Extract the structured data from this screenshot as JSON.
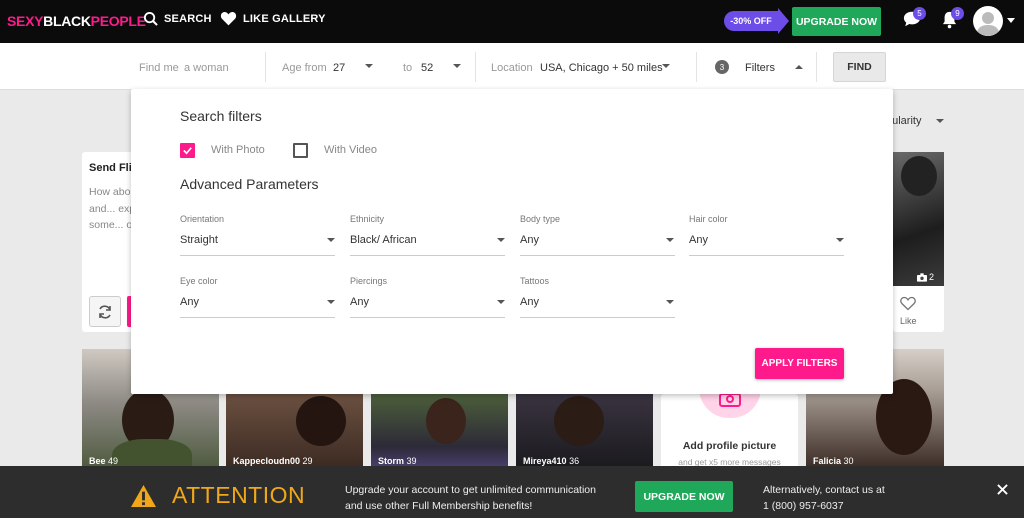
{
  "header": {
    "logo_part1": "SEXY",
    "logo_part2": "BLACK",
    "logo_part3": "PEOPLE",
    "search_label": "SEARCH",
    "like_gallery_label": "LIKE GALLERY",
    "promo_label": "-30% OFF",
    "upgrade_label": "UPGRADE NOW",
    "messages_count": "5",
    "notifications_count": "9"
  },
  "search": {
    "find_me_label": "Find me",
    "find_me_value": "a woman",
    "age_from_label": "Age from",
    "age_from_value": "27",
    "age_to_label": "to",
    "age_to_value": "52",
    "location_label": "Location",
    "location_value": "USA, Chicago + 50 miles",
    "filters_count": "3",
    "filters_label": "Filters",
    "find_label": "FIND"
  },
  "filters": {
    "title": "Search filters",
    "with_photo": "With Photo",
    "with_photo_checked": true,
    "with_video": "With Video",
    "with_video_checked": false,
    "advanced_title": "Advanced Parameters",
    "fields": [
      {
        "label": "Orientation",
        "value": "Straight"
      },
      {
        "label": "Ethnicity",
        "value": "Black/ African"
      },
      {
        "label": "Body type",
        "value": "Any"
      },
      {
        "label": "Hair color",
        "value": "Any"
      },
      {
        "label": "Eye color",
        "value": "Any"
      },
      {
        "label": "Piercings",
        "value": "Any"
      },
      {
        "label": "Tattoos",
        "value": "Any"
      }
    ],
    "apply_label": "APPLY FILTERS"
  },
  "background": {
    "sort_label": "pularity",
    "flirt_title": "Send Flir",
    "flirt_lines": [
      "How abo",
      "and... exp",
      "some... o"
    ],
    "top_photo_count": "2",
    "like_label": "Like",
    "add_photo_title": "Add profile picture",
    "add_photo_sub": "and get x5 more messages",
    "profiles": [
      {
        "name": "Bee",
        "age": "49"
      },
      {
        "name": "Kappecloudn00",
        "age": "29"
      },
      {
        "name": "Storm",
        "age": "39"
      },
      {
        "name": "Mireya410",
        "age": "36"
      },
      {
        "name": "Falicia",
        "age": "30"
      }
    ]
  },
  "attention": {
    "title": "ATTENTION",
    "line1": "Upgrade your account to get unlimited communication",
    "line2": "and use other Full Membership benefits!",
    "button_label": "UPGRADE NOW",
    "alt_line1": "Alternatively, contact us at",
    "alt_line2": "1 (800) 957-6037"
  }
}
